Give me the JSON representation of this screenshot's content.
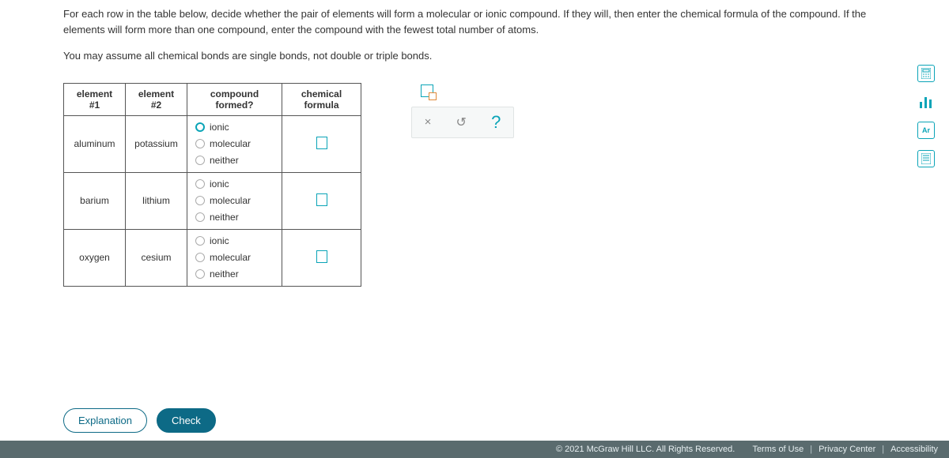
{
  "question": {
    "p1": "For each row in the table below, decide whether the pair of elements will form a molecular or ionic compound. If they will, then enter the chemical formula of the compound. If the elements will form more than one compound, enter the compound with the fewest total number of atoms.",
    "p2": "You may assume all chemical bonds are single bonds, not double or triple bonds."
  },
  "table": {
    "headers": {
      "e1": "element #1",
      "e2": "element #2",
      "compound": "compound formed?",
      "formula": "chemical formula"
    },
    "options": {
      "ionic": "ionic",
      "molecular": "molecular",
      "neither": "neither"
    },
    "rows": [
      {
        "e1": "aluminum",
        "e2": "potassium"
      },
      {
        "e1": "barium",
        "e2": "lithium"
      },
      {
        "e1": "oxygen",
        "e2": "cesium"
      }
    ]
  },
  "hint": {
    "close": "×",
    "reset": "↺",
    "help": "?"
  },
  "side_tools": {
    "calculator": "calculator-icon",
    "chart": "bar-chart-icon",
    "periodic": "Ar",
    "guide": "guide-icon"
  },
  "buttons": {
    "explanation": "Explanation",
    "check": "Check"
  },
  "footer": {
    "copyright": "© 2021 McGraw Hill LLC. All Rights Reserved.",
    "terms": "Terms of Use",
    "privacy": "Privacy Center",
    "accessibility": "Accessibility"
  }
}
